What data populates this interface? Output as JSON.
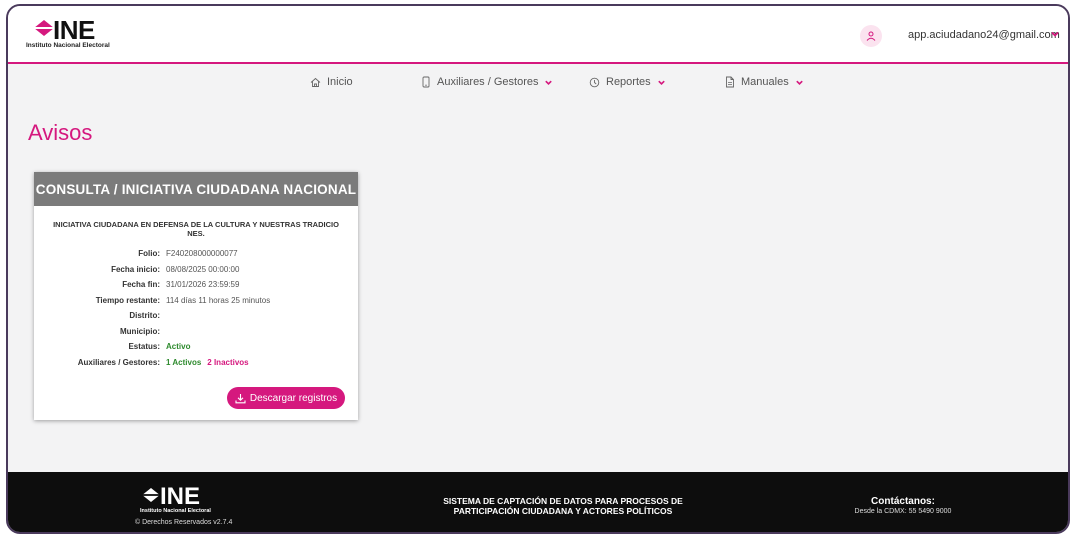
{
  "brand": {
    "logo_text": "INE",
    "logo_sub": "Instituto Nacional Electoral"
  },
  "user": {
    "email": "app.aciudadano24@gmail.com"
  },
  "nav": {
    "items": [
      {
        "label": "Inicio",
        "icon": "home-icon"
      },
      {
        "label": "Auxiliares / Gestores",
        "icon": "phone-icon",
        "has_dropdown": true
      },
      {
        "label": "Reportes",
        "icon": "clock-icon",
        "has_dropdown": true
      },
      {
        "label": "Manuales",
        "icon": "document-icon",
        "has_dropdown": true
      }
    ]
  },
  "page": {
    "title": "Avisos"
  },
  "card": {
    "header": "CONSULTA / INICIATIVA CIUDADANA NACIONAL",
    "subtitle": "INICIATIVA CIUDADANA EN DEFENSA DE LA CULTURA Y NUESTRAS TRADICIO NES.",
    "rows": [
      {
        "label": "Folio:",
        "value": "F240208000000077"
      },
      {
        "label": "Fecha inicio:",
        "value": "08/08/2025 00:00:00"
      },
      {
        "label": "Fecha fin:",
        "value": "31/01/2026 23:59:59"
      },
      {
        "label": "Tiempo restante:",
        "value": "114 días  11 horas  25 minutos"
      },
      {
        "label": "Distrito:",
        "value": ""
      },
      {
        "label": "Municipio:",
        "value": ""
      },
      {
        "label": "Estatus:",
        "value": "Activo"
      }
    ],
    "aux_label": "Auxiliares / Gestores:",
    "aux_active": "1  Activos",
    "aux_inactive": "2  Inactivos",
    "download_label": "Descargar registros"
  },
  "footer": {
    "logo_text": "INE",
    "logo_sub": "Instituto Nacional Electoral",
    "copyright": "© Derechos Reservados v2.7.4",
    "system_line1": "SISTEMA DE CAPTACIÓN DE DATOS PARA PROCESOS DE",
    "system_line2": "PARTICIPACIÓN CIUDADANA Y ACTORES POLÍTICOS",
    "contact_title": "Contáctanos:",
    "contact_phone": "Desde la CDMX: 55 5490 9000"
  },
  "colors": {
    "accent": "#d5187e",
    "card_header": "#7b7b7b",
    "active": "#2d8a2d",
    "footer_bg": "#0d0d0d"
  }
}
